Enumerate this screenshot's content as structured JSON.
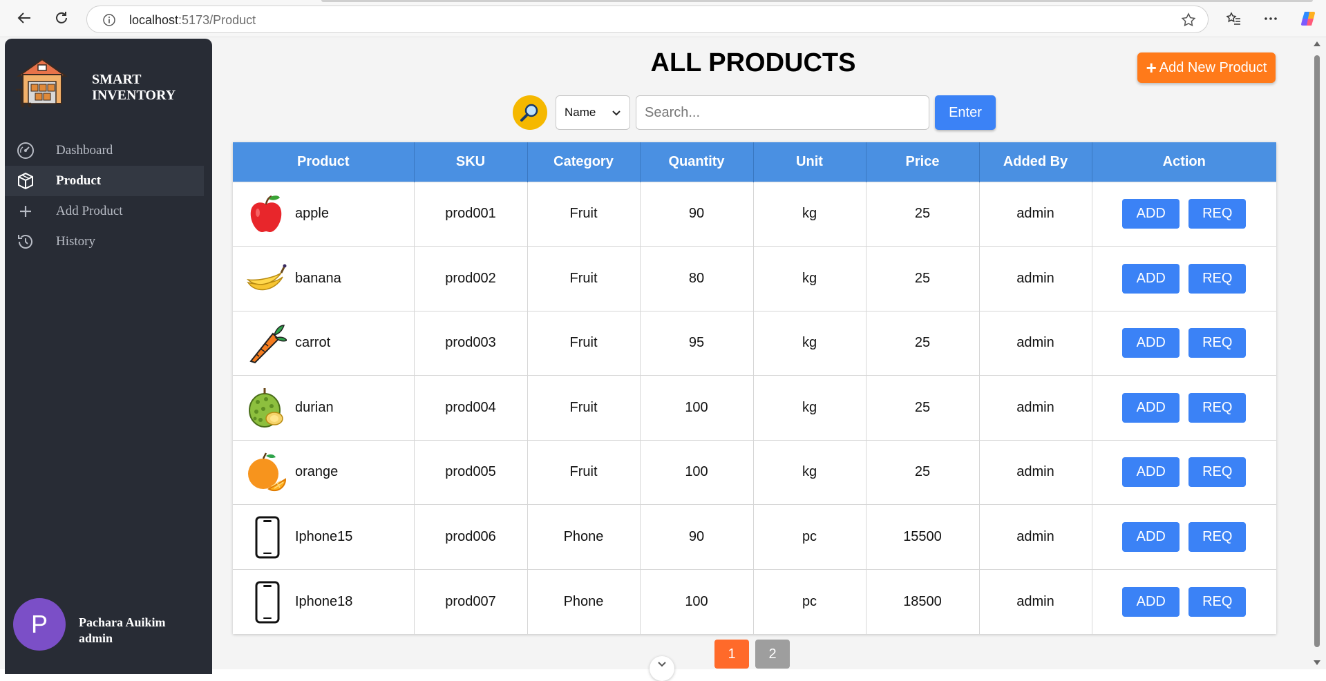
{
  "browser": {
    "url_host": "localhost",
    "url_rest": ":5173/Product"
  },
  "sidebar": {
    "brand": {
      "line1": "SMART",
      "line2": "INVENTORY"
    },
    "items": [
      {
        "label": "Dashboard",
        "icon": "dashboard-gauge-icon",
        "active": false
      },
      {
        "label": "Product",
        "icon": "cube-icon",
        "active": true
      },
      {
        "label": "Add Product",
        "icon": "plus-icon",
        "active": false
      },
      {
        "label": "History",
        "icon": "history-icon",
        "active": false
      }
    ],
    "user": {
      "initial": "P",
      "name": "Pachara Auikim",
      "role": "admin"
    }
  },
  "main": {
    "title": "ALL PRODUCTS",
    "add_new_label": "Add New Product",
    "search": {
      "filter_selected": "Name",
      "placeholder": "Search...",
      "enter_label": "Enter"
    },
    "table": {
      "headers": [
        "Product",
        "SKU",
        "Category",
        "Quantity",
        "Unit",
        "Price",
        "Added By",
        "Action"
      ],
      "action_labels": {
        "add": "ADD",
        "req": "REQ"
      },
      "rows": [
        {
          "name": "apple",
          "icon": "apple-icon",
          "sku": "prod001",
          "category": "Fruit",
          "quantity": "90",
          "unit": "kg",
          "price": "25",
          "added_by": "admin"
        },
        {
          "name": "banana",
          "icon": "banana-icon",
          "sku": "prod002",
          "category": "Fruit",
          "quantity": "80",
          "unit": "kg",
          "price": "25",
          "added_by": "admin"
        },
        {
          "name": "carrot",
          "icon": "carrot-icon",
          "sku": "prod003",
          "category": "Fruit",
          "quantity": "95",
          "unit": "kg",
          "price": "25",
          "added_by": "admin"
        },
        {
          "name": "durian",
          "icon": "durian-icon",
          "sku": "prod004",
          "category": "Fruit",
          "quantity": "100",
          "unit": "kg",
          "price": "25",
          "added_by": "admin"
        },
        {
          "name": "orange",
          "icon": "orange-icon",
          "sku": "prod005",
          "category": "Fruit",
          "quantity": "100",
          "unit": "kg",
          "price": "25",
          "added_by": "admin"
        },
        {
          "name": "Iphone15",
          "icon": "phone-icon",
          "sku": "prod006",
          "category": "Phone",
          "quantity": "90",
          "unit": "pc",
          "price": "15500",
          "added_by": "admin"
        },
        {
          "name": "Iphone18",
          "icon": "phone-icon",
          "sku": "prod007",
          "category": "Phone",
          "quantity": "100",
          "unit": "pc",
          "price": "18500",
          "added_by": "admin"
        }
      ]
    },
    "pagination": {
      "pages": [
        "1",
        "2"
      ],
      "current": "1"
    }
  },
  "colors": {
    "sidebar_bg": "#282c35",
    "header_blue": "#4a90e2",
    "button_blue": "#3b82f6",
    "accent_orange": "#ff7a1a",
    "avatar_purple": "#7b4fc7"
  }
}
